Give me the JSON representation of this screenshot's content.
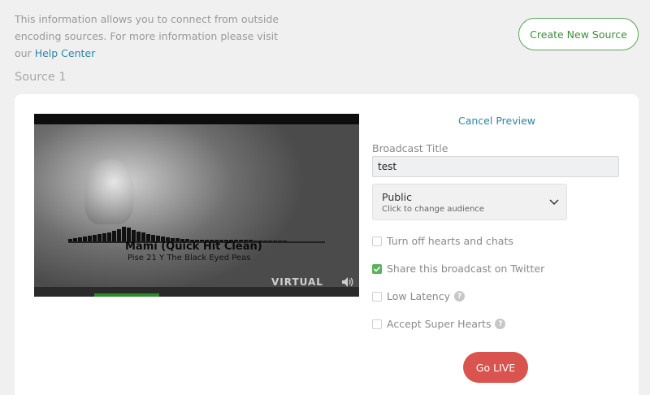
{
  "info": {
    "text": "This information allows you to connect from outside encoding sources. For more information please visit our ",
    "link": "Help Center"
  },
  "header": {
    "create_button": "Create New Source"
  },
  "source": {
    "title": "Source 1"
  },
  "video": {
    "song": "Mami (Quick Hit Clean)",
    "artist": "Pise 21 Y The Black Eyed Peas",
    "logo": "VIRTUAL",
    "progress": 0.2
  },
  "preview": {
    "cancel_label": "Cancel Preview"
  },
  "form": {
    "broadcast_title_label": "Broadcast Title",
    "broadcast_title_value": "test",
    "audience": {
      "label": "Public",
      "hint": "Click to change audience"
    },
    "options": [
      {
        "label": "Turn off hearts and chats",
        "checked": false,
        "help": false
      },
      {
        "label": "Share this broadcast on Twitter",
        "checked": true,
        "help": true
      },
      {
        "label": "Low Latency",
        "checked": false,
        "help": true
      },
      {
        "label": "Accept Super Hearts",
        "checked": false,
        "help": true
      }
    ],
    "go_live_label": "Go LIVE"
  },
  "colors": {
    "accent_green": "#58a854",
    "link_blue": "#2c86a3",
    "live_red": "#d9534f"
  }
}
